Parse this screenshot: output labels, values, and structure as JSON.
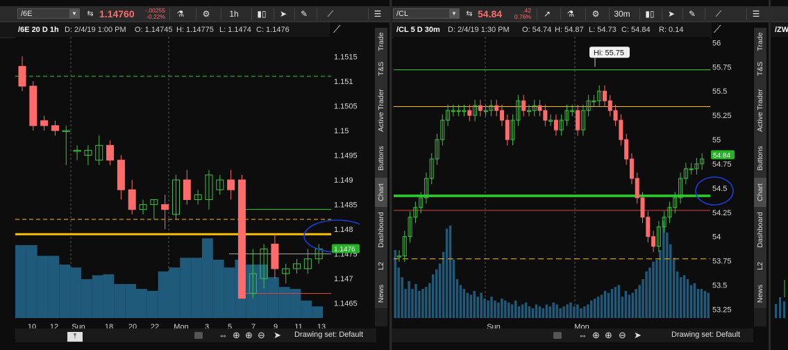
{
  "panel1": {
    "symbol": "/6E",
    "price": "1.14760",
    "change_abs": "-.00255",
    "change_pct": "-0.22%",
    "timeframe": "1h",
    "info": {
      "sym_period": "/6E 20 D 1h",
      "date": "D: 2/4/19 1:00 PM",
      "open": "O: 1.14745",
      "high": "H: 1.14775",
      "low": "L: 1.1474",
      "close": "C: 1.1476"
    },
    "y_labels": [
      "1.1515",
      "1.151",
      "1.1505",
      "1.15",
      "1.1495",
      "1.149",
      "1.1485",
      "1.148",
      "1.1475",
      "1.147",
      "1.1465"
    ],
    "last_label": "1.1476",
    "x_labels": [
      "10",
      "12",
      "Sun",
      "18",
      "20",
      "22",
      "Mon",
      "3",
      "5",
      "7",
      "9",
      "11",
      "13"
    ],
    "drawing_set": "Drawing set: Default",
    "tabs": [
      "Trade",
      "T&S",
      "Active Trader",
      "Buttons",
      "Chart",
      "Dashboard",
      "L2",
      "News"
    ]
  },
  "panel2": {
    "symbol": "/CL",
    "price": "54.84",
    "change_abs": ".42",
    "change_pct": "0.76%",
    "timeframe": "30m",
    "info": {
      "sym_period": "/CL 5 D 30m",
      "date": "D: 2/4/19 1:30 PM",
      "open": "O: 54.74",
      "high": "H: 54.87",
      "low": "L: 54.73",
      "close": "C: 54.84",
      "r": "R: 0.14"
    },
    "hi_bubble": "Hi: 55.75",
    "y_labels": [
      "56",
      "55.75",
      "55.5",
      "55.25",
      "55",
      "54.75",
      "54.5",
      "54.25",
      "54",
      "53.75",
      "53.5",
      "53.25"
    ],
    "last_label": "54.84",
    "x_labels": [
      "Sun",
      "Mon"
    ],
    "drawing_set": "Drawing set: Default",
    "tabs": [
      "Trade",
      "T&S",
      "Active Trader",
      "Buttons",
      "Chart",
      "Dashboard",
      "L2",
      "News"
    ]
  },
  "panel3": {
    "info_sym": "/ZW"
  },
  "colors": {
    "up": "#3ec43e",
    "down": "#ff6b6b",
    "volume": "#1f5a7a",
    "annot": "#1a3fd6",
    "yellow": "#ffc000",
    "green_line": "#2bd12b"
  },
  "chart_data": [
    {
      "type": "candlestick",
      "title": "/6E 20 D 1h",
      "ylim": [
        1.1462,
        1.1519
      ],
      "x_ticks": [
        "10",
        "12",
        "Sun",
        "18",
        "20",
        "22",
        "Mon",
        "3",
        "5",
        "7",
        "9",
        "11",
        "13"
      ],
      "candles": [
        [
          1.1513,
          1.1515,
          1.1508,
          1.1509
        ],
        [
          1.1509,
          1.151,
          1.15,
          1.1501
        ],
        [
          1.1502,
          1.1503,
          1.15,
          1.1501
        ],
        [
          1.1501,
          1.1502,
          1.1499,
          1.15
        ],
        [
          1.15,
          1.1501,
          1.1493,
          1.15
        ],
        [
          1.1496,
          1.1497,
          1.1494,
          1.1496
        ],
        [
          1.1495,
          1.1497,
          1.1493,
          1.1496
        ],
        [
          1.1494,
          1.1499,
          1.1493,
          1.1497
        ],
        [
          1.1497,
          1.1498,
          1.1493,
          1.1494
        ],
        [
          1.1494,
          1.1495,
          1.1486,
          1.1488
        ],
        [
          1.1488,
          1.149,
          1.1483,
          1.1484
        ],
        [
          1.1484,
          1.1486,
          1.1483,
          1.1485
        ],
        [
          1.1485,
          1.1486,
          1.1482,
          1.1486
        ],
        [
          1.1485,
          1.1487,
          1.148,
          1.1484
        ],
        [
          1.1483,
          1.1491,
          1.1482,
          1.149
        ],
        [
          1.149,
          1.1492,
          1.1485,
          1.1486
        ],
        [
          1.1486,
          1.1488,
          1.1485,
          1.1487
        ],
        [
          1.1486,
          1.1492,
          1.1484,
          1.1491
        ],
        [
          1.1488,
          1.1491,
          1.1487,
          1.149
        ],
        [
          1.149,
          1.1492,
          1.1486,
          1.1488
        ],
        [
          1.149,
          1.1491,
          1.1468,
          1.1466
        ],
        [
          1.1467,
          1.1476,
          1.1466,
          1.1471
        ],
        [
          1.147,
          1.1477,
          1.1468,
          1.1476
        ],
        [
          1.1477,
          1.1479,
          1.147,
          1.1472
        ],
        [
          1.1471,
          1.1473,
          1.1469,
          1.1472
        ],
        [
          1.1472,
          1.1474,
          1.1471,
          1.1473
        ],
        [
          1.1472,
          1.1476,
          1.1471,
          1.1474
        ],
        [
          1.1474,
          1.1477,
          1.1473,
          1.1476
        ]
      ],
      "volume": [
        75,
        75,
        64,
        64,
        55,
        52,
        40,
        44,
        45,
        35,
        35,
        30,
        28,
        48,
        52,
        62,
        62,
        82,
        60,
        52,
        60,
        55,
        55,
        42,
        32,
        30,
        18,
        12
      ],
      "hlines": [
        1.1511,
        1.1484,
        1.1482,
        1.1479,
        1.1475,
        1.1467
      ]
    },
    {
      "type": "candlestick",
      "title": "/CL 5 D 30m",
      "ylim": [
        53.16,
        56.06
      ],
      "x_ticks": [
        "Sun",
        "Mon"
      ],
      "hi_label": "Hi: 55.75",
      "hlines": [
        55.72,
        55.34,
        54.42,
        54.27,
        53.77
      ]
    }
  ]
}
